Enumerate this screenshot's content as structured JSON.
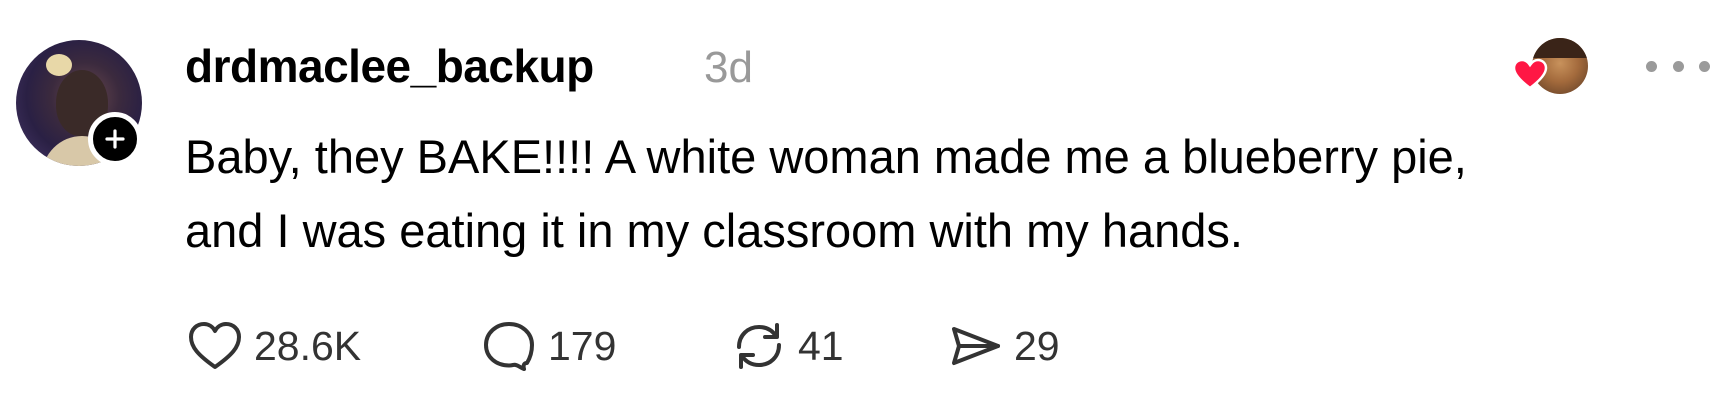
{
  "post": {
    "username": "drdmaclee_backup",
    "timestamp": "3d",
    "text_lines": [
      "Baby, they BAKE!!!! A white woman made me a blueberry pie,",
      "and I was eating it in my classroom with my hands."
    ],
    "stats": {
      "likes": "28.6K",
      "comments": "179",
      "reposts": "41",
      "shares": "29"
    }
  },
  "icons": {
    "follow": "plus-icon",
    "like": "heart-icon",
    "comment": "speech-bubble-icon",
    "repost": "repost-arrows-icon",
    "share": "paper-plane-icon",
    "more": "ellipsis-icon",
    "liked_by_badge": "heart-icon"
  },
  "colors": {
    "text": "#000000",
    "muted": "#999999",
    "icon": "#333333",
    "heart_badge": "#ff1744"
  }
}
